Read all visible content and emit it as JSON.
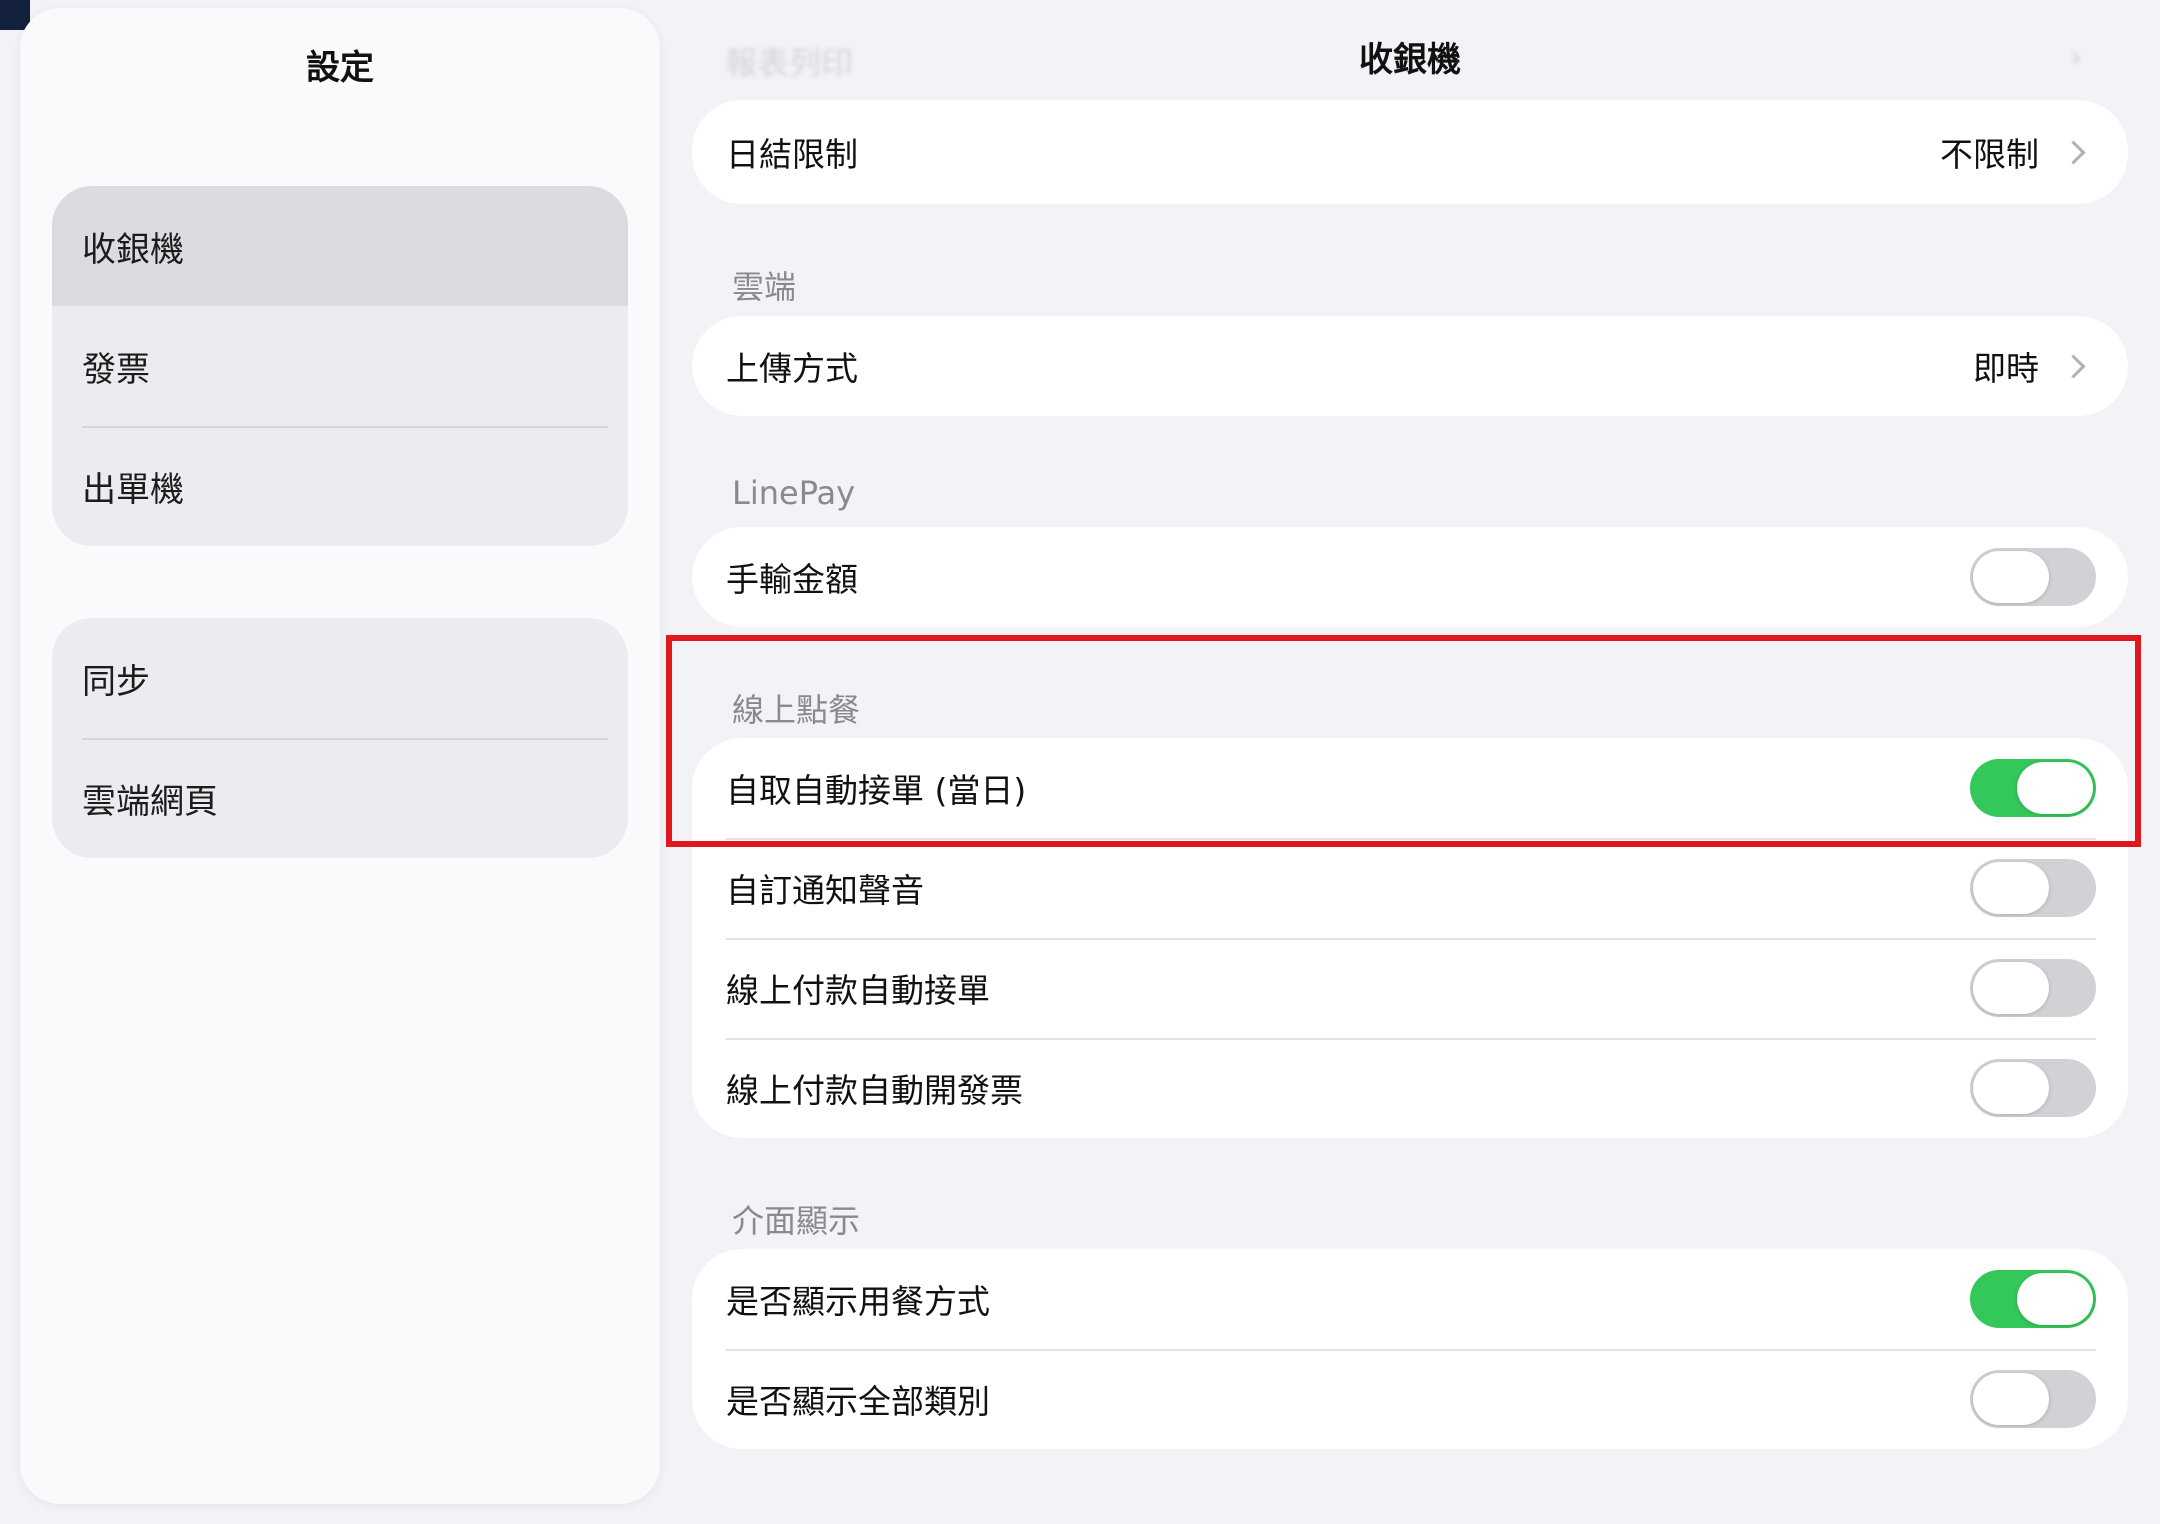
{
  "sidebar": {
    "title": "設定",
    "groups": [
      {
        "items": [
          {
            "label": "收銀機",
            "selected": true
          },
          {
            "label": "發票"
          },
          {
            "label": "出單機"
          }
        ]
      },
      {
        "items": [
          {
            "label": "同步"
          },
          {
            "label": "雲端網頁"
          }
        ]
      }
    ]
  },
  "main": {
    "title": "收銀機",
    "faded_row_label": "報表列印",
    "daily_close": {
      "label": "日結限制",
      "value": "不限制"
    },
    "cloud": {
      "header": "雲端",
      "upload": {
        "label": "上傳方式",
        "value": "即時"
      }
    },
    "linepay": {
      "header": "LinePay",
      "manual_amount": {
        "label": "手輸金額",
        "on": false
      }
    },
    "online_order": {
      "header": "線上點餐",
      "rows": [
        {
          "label": "自取自動接單 (當日)",
          "on": true
        },
        {
          "label": "自訂通知聲音",
          "on": false
        },
        {
          "label": "線上付款自動接單",
          "on": false
        },
        {
          "label": "線上付款自動開發票",
          "on": false
        }
      ]
    },
    "display": {
      "header": "介面顯示",
      "rows": [
        {
          "label": "是否顯示用餐方式",
          "on": true
        },
        {
          "label": "是否顯示全部類別",
          "on": false
        }
      ]
    }
  },
  "colors": {
    "toggle_on": "#34c759",
    "toggle_off": "#d2d2d6",
    "highlight": "#e1171e"
  }
}
